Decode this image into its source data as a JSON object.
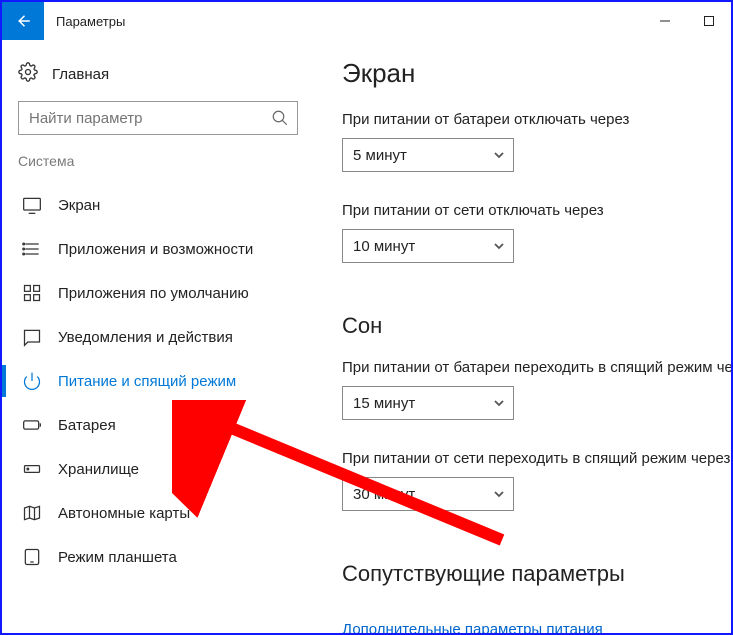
{
  "titlebar": {
    "title": "Параметры"
  },
  "sidebar": {
    "home": "Главная",
    "search_placeholder": "Найти параметр",
    "section": "Система",
    "items": [
      {
        "label": "Экран"
      },
      {
        "label": "Приложения и возможности"
      },
      {
        "label": "Приложения по умолчанию"
      },
      {
        "label": "Уведомления и действия"
      },
      {
        "label": "Питание и спящий режим"
      },
      {
        "label": "Батарея"
      },
      {
        "label": "Хранилище"
      },
      {
        "label": "Автономные карты"
      },
      {
        "label": "Режим планшета"
      }
    ]
  },
  "main": {
    "screen": {
      "heading": "Экран",
      "battery_label": "При питании от батареи отключать через",
      "battery_value": "5 минут",
      "plugged_label": "При питании от сети отключать через",
      "plugged_value": "10 минут"
    },
    "sleep": {
      "heading": "Сон",
      "battery_label": "При питании от батареи переходить в спящий режим через",
      "battery_value": "15 минут",
      "plugged_label": "При питании от сети переходить в спящий режим через",
      "plugged_value": "30 минут"
    },
    "related": {
      "heading": "Сопутствующие параметры",
      "link": "Дополнительные параметры питания"
    }
  }
}
